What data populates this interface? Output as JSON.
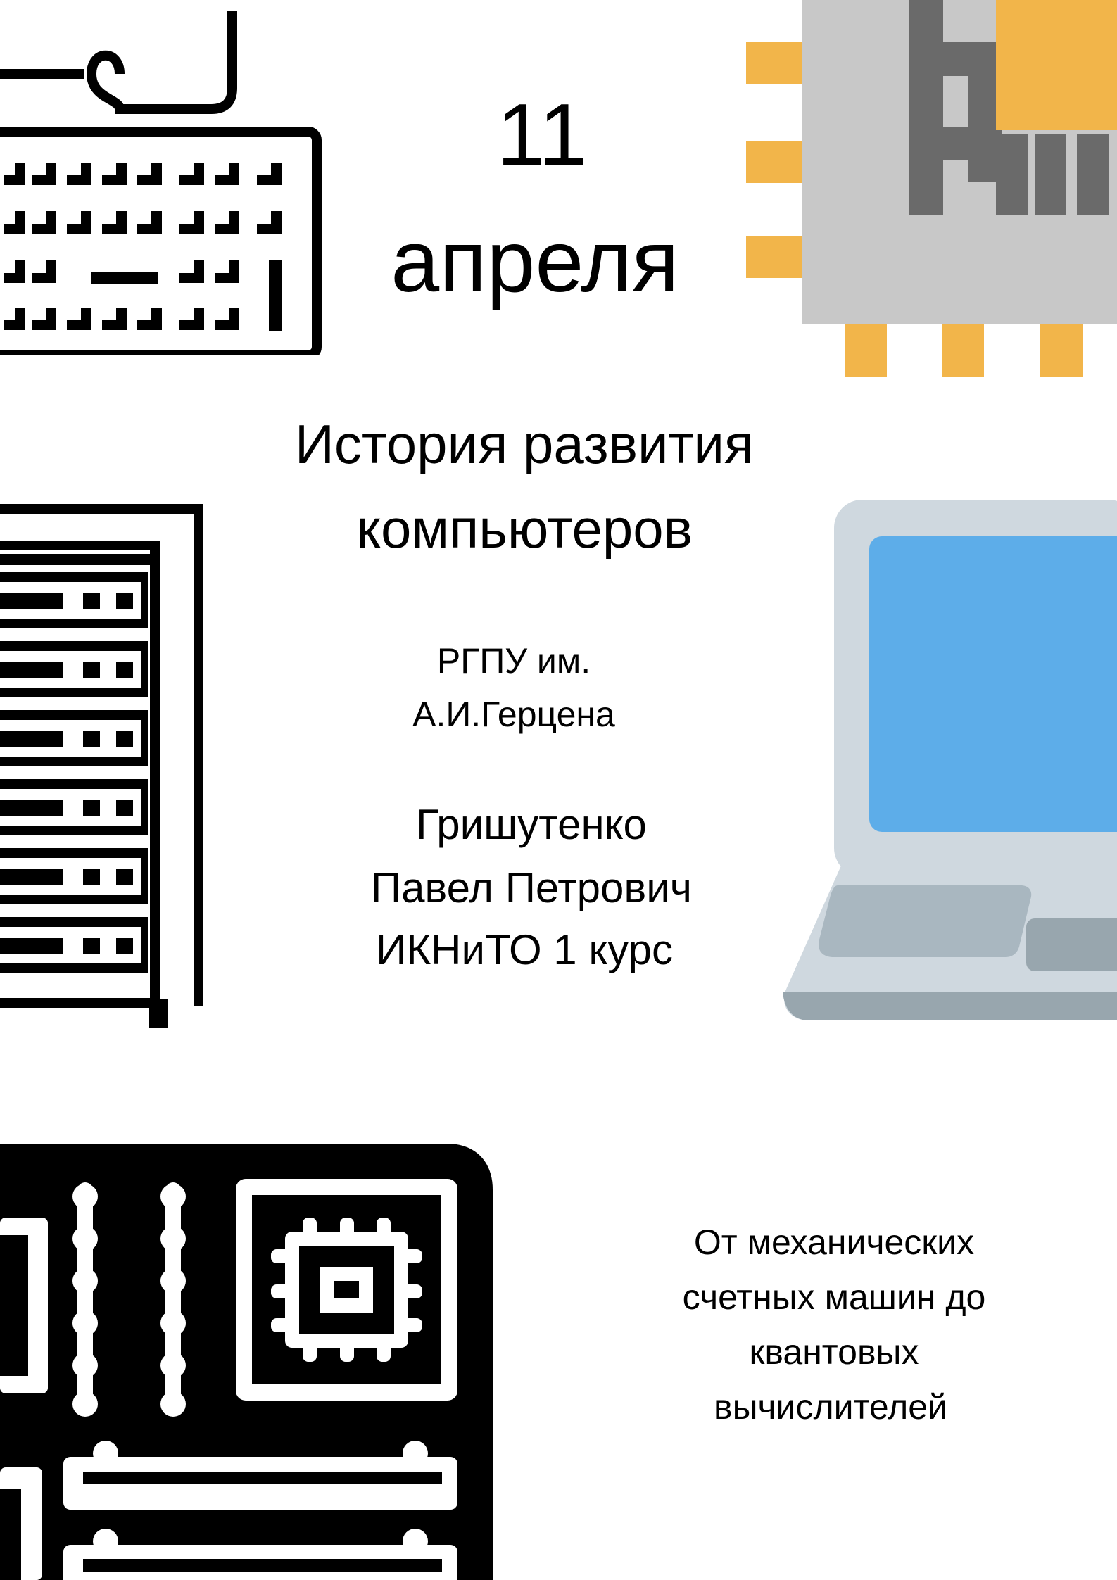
{
  "date": {
    "line1": "11",
    "line2": "апреля"
  },
  "title": {
    "line1": "История развития",
    "line2": "компьютеров"
  },
  "university": {
    "line1": "РГПУ им.",
    "line2": "А.И.Герцена"
  },
  "author": {
    "line1": "Гришутенко",
    "line2": "Павел Петрович",
    "line3": "ИКНиТО 1 курс"
  },
  "description": {
    "line1": "От механических",
    "line2": "счетных машин до",
    "line3": "квантовых",
    "line4": "вычислителей"
  },
  "icons": {
    "keyboard": "keyboard-icon",
    "chip": "cpu-chip-icon",
    "server": "server-rack-icon",
    "laptop": "laptop-icon",
    "motherboard": "motherboard-icon"
  },
  "colors": {
    "background": "#ffffff",
    "text": "#000000",
    "icon_black": "#000000",
    "chip_orange": "#f2b54a",
    "chip_body": "#c8c8c8",
    "chip_dark": "#6a6a6a",
    "laptop_frame": "#cfd8df",
    "laptop_screen": "#5dade9",
    "laptop_base": "#a9b7c0",
    "laptop_shadow": "#98a6ae"
  }
}
